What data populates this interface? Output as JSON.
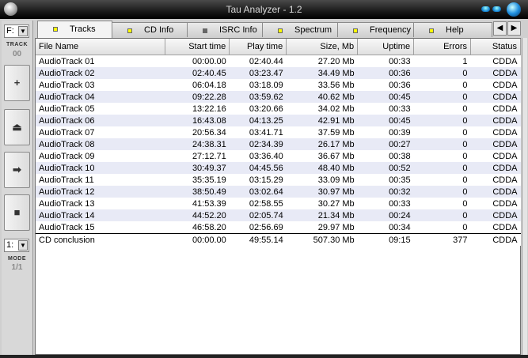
{
  "window": {
    "title": "Tau Analyzer - 1.2"
  },
  "left": {
    "drive_letter": "F:",
    "track_label": "TRACK",
    "track_number": "00",
    "buttons": [
      {
        "name": "add",
        "glyph": "+"
      },
      {
        "name": "eject",
        "glyph": "⏏"
      },
      {
        "name": "next",
        "glyph": "➡"
      },
      {
        "name": "stop",
        "glyph": "■"
      }
    ],
    "mode_value": "1:",
    "mode_label": "MODE",
    "mode_number": "1/1"
  },
  "tabs": [
    {
      "label": "Tracks",
      "led": "yellow",
      "active": true
    },
    {
      "label": "CD Info",
      "led": "yellow"
    },
    {
      "label": "ISRC Info",
      "led": "grey"
    },
    {
      "label": "Spectrum",
      "led": "yellow"
    },
    {
      "label": "Frequency",
      "led": "yellow"
    },
    {
      "label": "Help",
      "led": "yellow"
    }
  ],
  "table": {
    "columns": [
      "File Name",
      "Start time",
      "Play time",
      "Size, Mb",
      "Uptime",
      "Errors",
      "Status"
    ],
    "rows": [
      [
        "AudioTrack 01",
        "00:00.00",
        "02:40.44",
        "27.20 Mb",
        "00:33",
        "1",
        "CDDA"
      ],
      [
        "AudioTrack 02",
        "02:40.45",
        "03:23.47",
        "34.49 Mb",
        "00:36",
        "0",
        "CDDA"
      ],
      [
        "AudioTrack 03",
        "06:04.18",
        "03:18.09",
        "33.56 Mb",
        "00:36",
        "0",
        "CDDA"
      ],
      [
        "AudioTrack 04",
        "09:22.28",
        "03:59.62",
        "40.62 Mb",
        "00:45",
        "0",
        "CDDA"
      ],
      [
        "AudioTrack 05",
        "13:22.16",
        "03:20.66",
        "34.02 Mb",
        "00:33",
        "0",
        "CDDA"
      ],
      [
        "AudioTrack 06",
        "16:43.08",
        "04:13.25",
        "42.91 Mb",
        "00:45",
        "0",
        "CDDA"
      ],
      [
        "AudioTrack 07",
        "20:56.34",
        "03:41.71",
        "37.59 Mb",
        "00:39",
        "0",
        "CDDA"
      ],
      [
        "AudioTrack 08",
        "24:38.31",
        "02:34.39",
        "26.17 Mb",
        "00:27",
        "0",
        "CDDA"
      ],
      [
        "AudioTrack 09",
        "27:12.71",
        "03:36.40",
        "36.67 Mb",
        "00:38",
        "0",
        "CDDA"
      ],
      [
        "AudioTrack 10",
        "30:49.37",
        "04:45.56",
        "48.40 Mb",
        "00:52",
        "0",
        "CDDA"
      ],
      [
        "AudioTrack 11",
        "35:35.19",
        "03:15.29",
        "33.09 Mb",
        "00:35",
        "0",
        "CDDA"
      ],
      [
        "AudioTrack 12",
        "38:50.49",
        "03:02.64",
        "30.97 Mb",
        "00:32",
        "0",
        "CDDA"
      ],
      [
        "AudioTrack 13",
        "41:53.39",
        "02:58.55",
        "30.27 Mb",
        "00:33",
        "0",
        "CDDA"
      ],
      [
        "AudioTrack 14",
        "44:52.20",
        "02:05.74",
        "21.34 Mb",
        "00:24",
        "0",
        "CDDA"
      ],
      [
        "AudioTrack 15",
        "46:58.20",
        "02:56.69",
        "29.97 Mb",
        "00:34",
        "0",
        "CDDA"
      ]
    ],
    "conclusion": [
      "CD conclusion",
      "00:00.00",
      "49:55.14",
      "507.30 Mb",
      "09:15",
      "377",
      "CDDA"
    ]
  }
}
